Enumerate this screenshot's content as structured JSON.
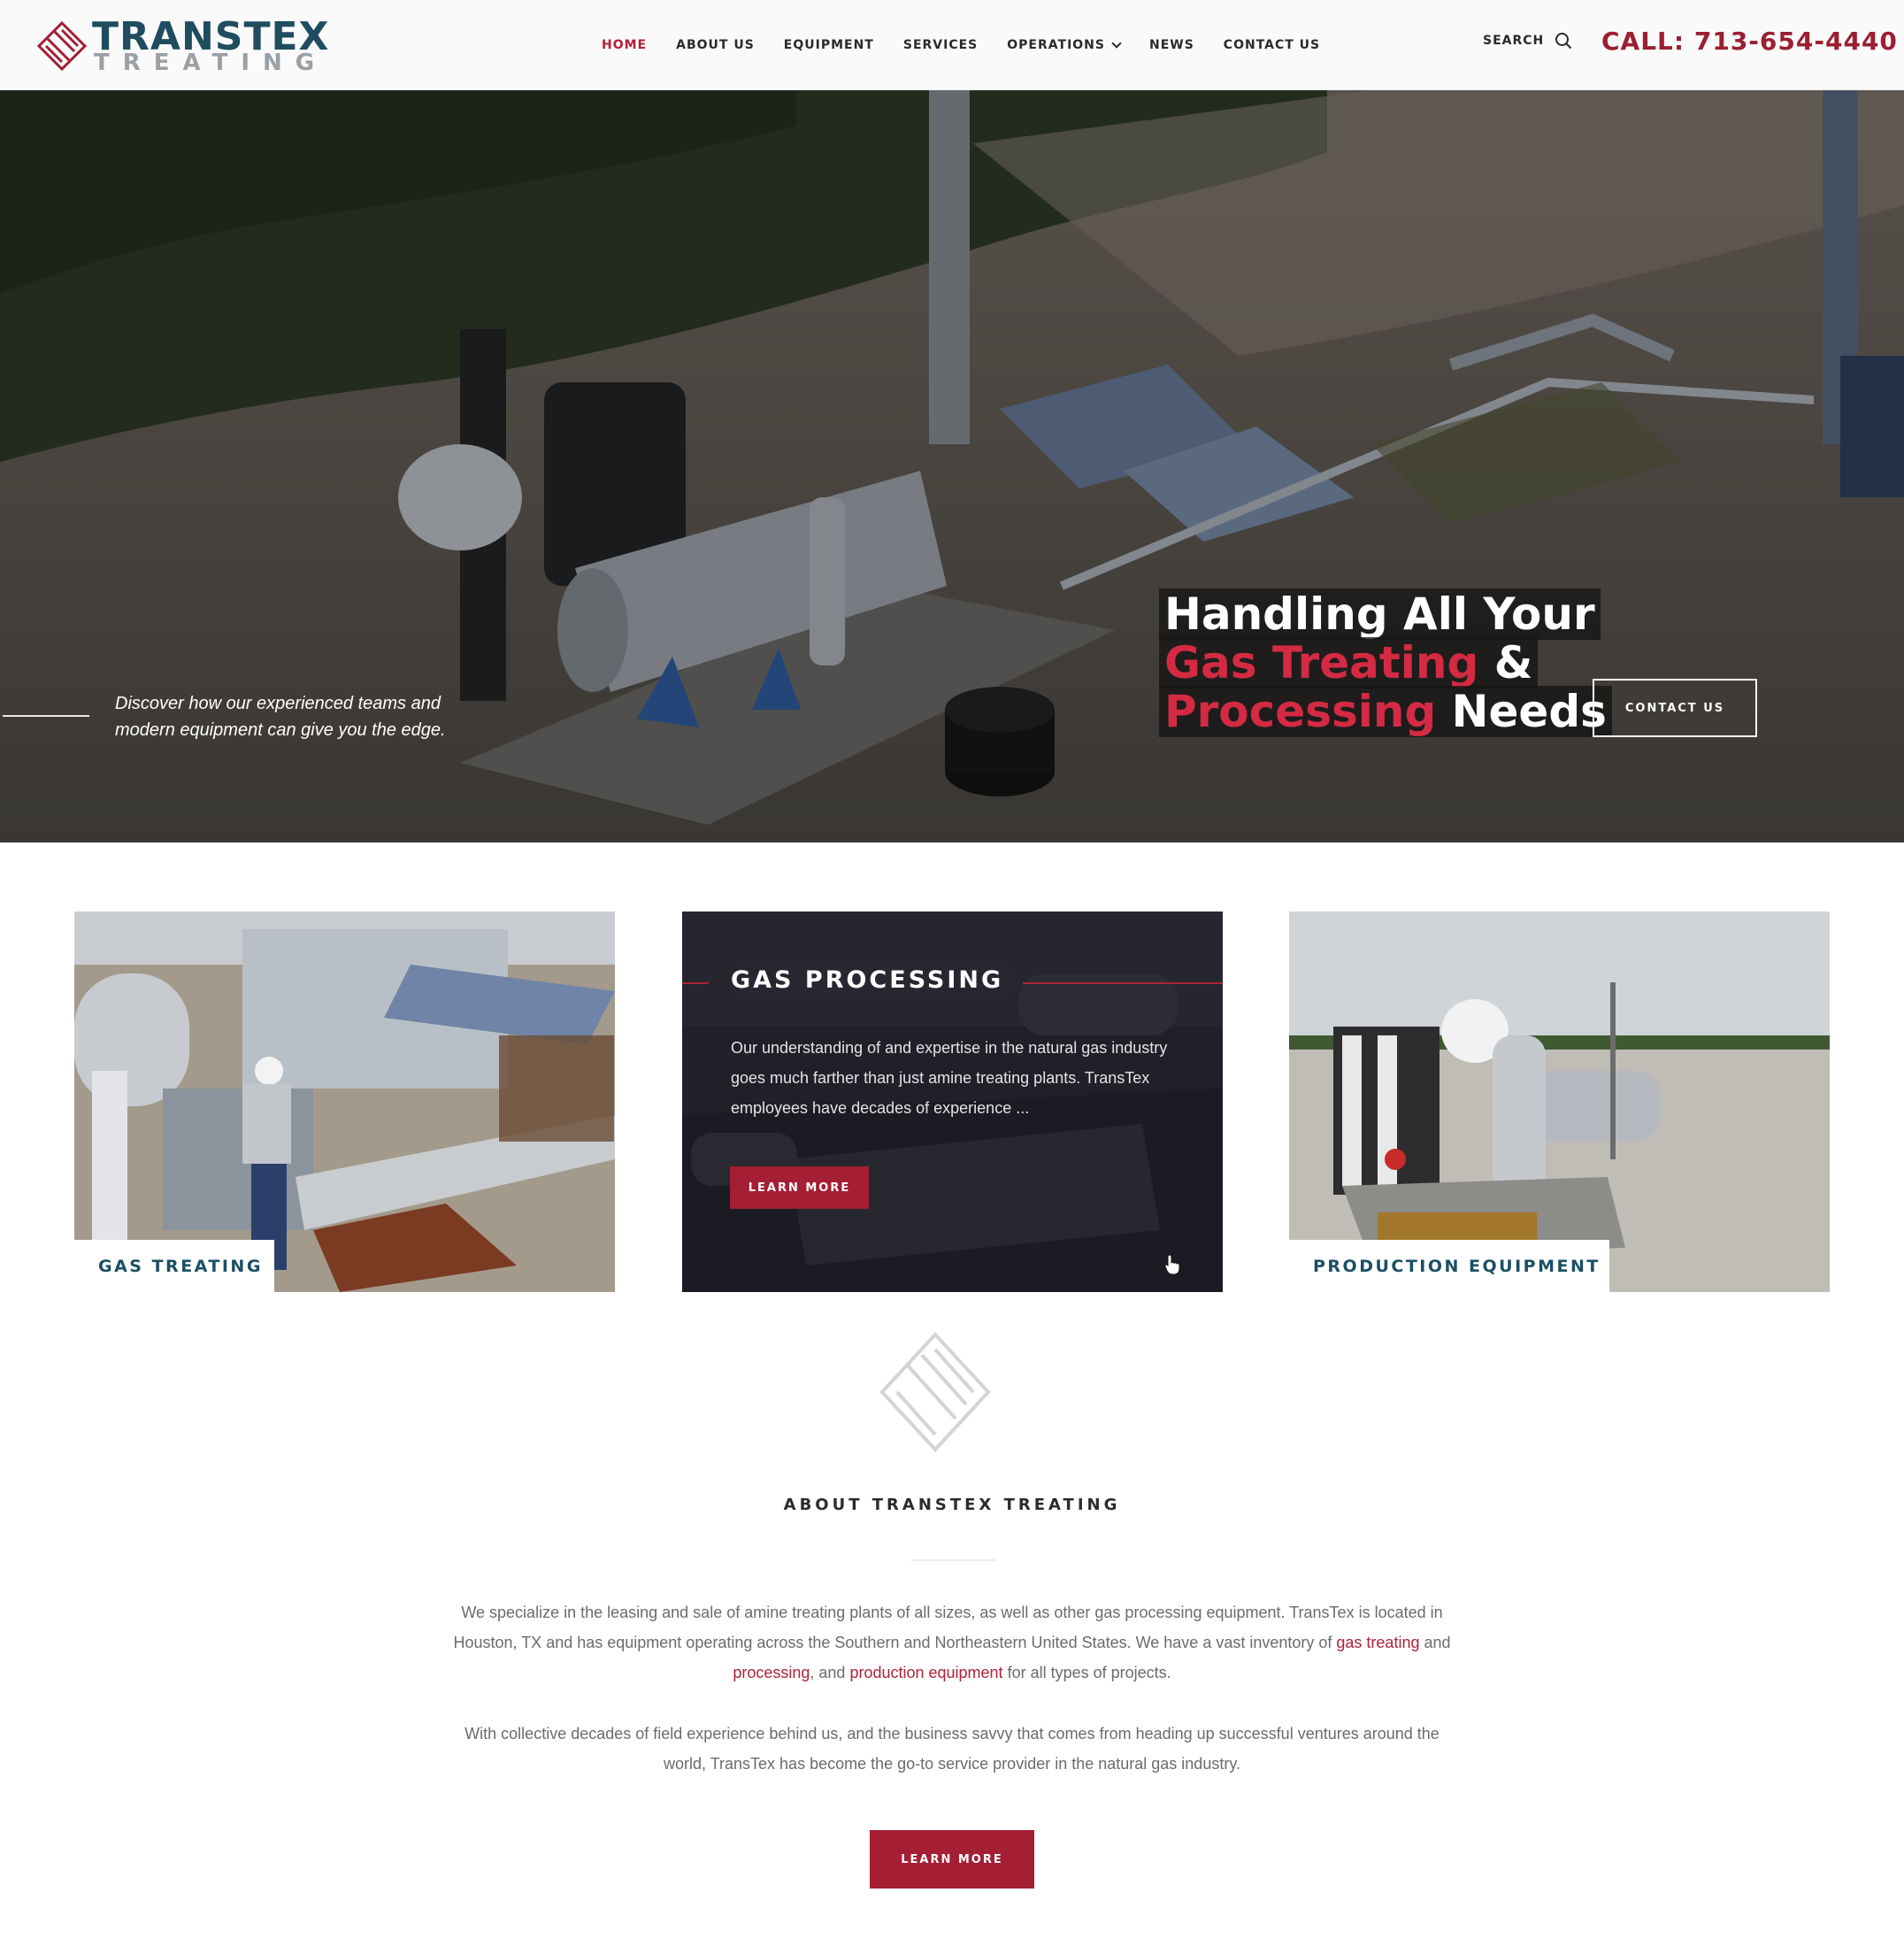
{
  "brand": {
    "name_line1": "TRANSTEX",
    "name_line2": "TREATING",
    "primary_color": "#1f4d5f",
    "accent_color": "#b0213a",
    "logo_icon": "diamond-stripes-logo-icon"
  },
  "nav": {
    "items": [
      {
        "label": "HOME",
        "active": true
      },
      {
        "label": "ABOUT US",
        "active": false
      },
      {
        "label": "EQUIPMENT",
        "active": false
      },
      {
        "label": "SERVICES",
        "active": false
      },
      {
        "label": "OPERATIONS",
        "active": false,
        "dropdown": true
      },
      {
        "label": "NEWS",
        "active": false
      },
      {
        "label": "CONTACT US",
        "active": false
      }
    ],
    "search_label": "SEARCH",
    "search_icon": "search-icon",
    "call_label": "CALL: 713-654-4440"
  },
  "hero": {
    "subtitle": "Discover how our experienced teams and modern equipment can give you the edge.",
    "title_line1": "Handling All Your",
    "title_line2_red": "Gas Treating",
    "title_line2_white": " &",
    "title_line3_red": "Processing",
    "title_line3_white": " Needs",
    "cta_label": "CONTACT US"
  },
  "cards": [
    {
      "label": "GAS TREATING"
    },
    {
      "title": "GAS PROCESSING",
      "text": "Our understanding of and expertise in the natural gas industry goes much farther than just amine treating plants. TransTex employees have decades of experience ...",
      "button_label": "LEARN MORE"
    },
    {
      "label": "PRODUCTION EQUIPMENT"
    }
  ],
  "about": {
    "title": "ABOUT TRANSTEX TREATING",
    "p1_a": "We specialize in the leasing and sale of amine treating plants of all sizes, as well as other gas processing equipment. TransTex is located in Houston, TX and has equipment operating across the Southern and Northeastern United States. We have a vast inventory of ",
    "link_gas_treating": "gas treating",
    "p1_b": " and ",
    "link_processing": "processing",
    "p1_c": ", and ",
    "link_production": "production equipment",
    "p1_d": " for all types of projects.",
    "p2": "With collective decades of field experience behind us, and the business savvy that comes from heading up successful ventures around the world, TransTex has become the go-to service provider in the natural gas industry.",
    "button_label": "LEARN MORE"
  }
}
